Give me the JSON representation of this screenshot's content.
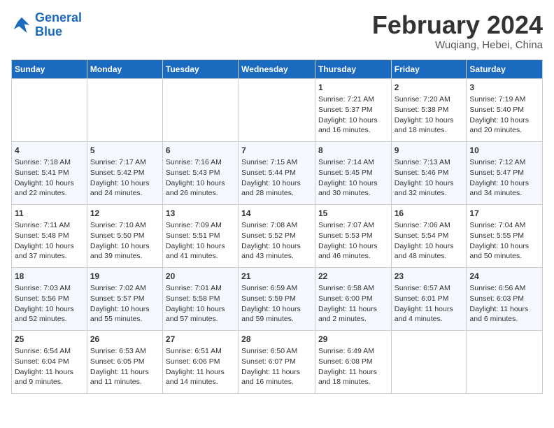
{
  "header": {
    "logo_line1": "General",
    "logo_line2": "Blue",
    "month": "February 2024",
    "location": "Wuqiang, Hebei, China"
  },
  "weekdays": [
    "Sunday",
    "Monday",
    "Tuesday",
    "Wednesday",
    "Thursday",
    "Friday",
    "Saturday"
  ],
  "weeks": [
    [
      {
        "day": "",
        "text": ""
      },
      {
        "day": "",
        "text": ""
      },
      {
        "day": "",
        "text": ""
      },
      {
        "day": "",
        "text": ""
      },
      {
        "day": "1",
        "text": "Sunrise: 7:21 AM\nSunset: 5:37 PM\nDaylight: 10 hours\nand 16 minutes."
      },
      {
        "day": "2",
        "text": "Sunrise: 7:20 AM\nSunset: 5:38 PM\nDaylight: 10 hours\nand 18 minutes."
      },
      {
        "day": "3",
        "text": "Sunrise: 7:19 AM\nSunset: 5:40 PM\nDaylight: 10 hours\nand 20 minutes."
      }
    ],
    [
      {
        "day": "4",
        "text": "Sunrise: 7:18 AM\nSunset: 5:41 PM\nDaylight: 10 hours\nand 22 minutes."
      },
      {
        "day": "5",
        "text": "Sunrise: 7:17 AM\nSunset: 5:42 PM\nDaylight: 10 hours\nand 24 minutes."
      },
      {
        "day": "6",
        "text": "Sunrise: 7:16 AM\nSunset: 5:43 PM\nDaylight: 10 hours\nand 26 minutes."
      },
      {
        "day": "7",
        "text": "Sunrise: 7:15 AM\nSunset: 5:44 PM\nDaylight: 10 hours\nand 28 minutes."
      },
      {
        "day": "8",
        "text": "Sunrise: 7:14 AM\nSunset: 5:45 PM\nDaylight: 10 hours\nand 30 minutes."
      },
      {
        "day": "9",
        "text": "Sunrise: 7:13 AM\nSunset: 5:46 PM\nDaylight: 10 hours\nand 32 minutes."
      },
      {
        "day": "10",
        "text": "Sunrise: 7:12 AM\nSunset: 5:47 PM\nDaylight: 10 hours\nand 34 minutes."
      }
    ],
    [
      {
        "day": "11",
        "text": "Sunrise: 7:11 AM\nSunset: 5:48 PM\nDaylight: 10 hours\nand 37 minutes."
      },
      {
        "day": "12",
        "text": "Sunrise: 7:10 AM\nSunset: 5:50 PM\nDaylight: 10 hours\nand 39 minutes."
      },
      {
        "day": "13",
        "text": "Sunrise: 7:09 AM\nSunset: 5:51 PM\nDaylight: 10 hours\nand 41 minutes."
      },
      {
        "day": "14",
        "text": "Sunrise: 7:08 AM\nSunset: 5:52 PM\nDaylight: 10 hours\nand 43 minutes."
      },
      {
        "day": "15",
        "text": "Sunrise: 7:07 AM\nSunset: 5:53 PM\nDaylight: 10 hours\nand 46 minutes."
      },
      {
        "day": "16",
        "text": "Sunrise: 7:06 AM\nSunset: 5:54 PM\nDaylight: 10 hours\nand 48 minutes."
      },
      {
        "day": "17",
        "text": "Sunrise: 7:04 AM\nSunset: 5:55 PM\nDaylight: 10 hours\nand 50 minutes."
      }
    ],
    [
      {
        "day": "18",
        "text": "Sunrise: 7:03 AM\nSunset: 5:56 PM\nDaylight: 10 hours\nand 52 minutes."
      },
      {
        "day": "19",
        "text": "Sunrise: 7:02 AM\nSunset: 5:57 PM\nDaylight: 10 hours\nand 55 minutes."
      },
      {
        "day": "20",
        "text": "Sunrise: 7:01 AM\nSunset: 5:58 PM\nDaylight: 10 hours\nand 57 minutes."
      },
      {
        "day": "21",
        "text": "Sunrise: 6:59 AM\nSunset: 5:59 PM\nDaylight: 10 hours\nand 59 minutes."
      },
      {
        "day": "22",
        "text": "Sunrise: 6:58 AM\nSunset: 6:00 PM\nDaylight: 11 hours\nand 2 minutes."
      },
      {
        "day": "23",
        "text": "Sunrise: 6:57 AM\nSunset: 6:01 PM\nDaylight: 11 hours\nand 4 minutes."
      },
      {
        "day": "24",
        "text": "Sunrise: 6:56 AM\nSunset: 6:03 PM\nDaylight: 11 hours\nand 6 minutes."
      }
    ],
    [
      {
        "day": "25",
        "text": "Sunrise: 6:54 AM\nSunset: 6:04 PM\nDaylight: 11 hours\nand 9 minutes."
      },
      {
        "day": "26",
        "text": "Sunrise: 6:53 AM\nSunset: 6:05 PM\nDaylight: 11 hours\nand 11 minutes."
      },
      {
        "day": "27",
        "text": "Sunrise: 6:51 AM\nSunset: 6:06 PM\nDaylight: 11 hours\nand 14 minutes."
      },
      {
        "day": "28",
        "text": "Sunrise: 6:50 AM\nSunset: 6:07 PM\nDaylight: 11 hours\nand 16 minutes."
      },
      {
        "day": "29",
        "text": "Sunrise: 6:49 AM\nSunset: 6:08 PM\nDaylight: 11 hours\nand 18 minutes."
      },
      {
        "day": "",
        "text": ""
      },
      {
        "day": "",
        "text": ""
      }
    ]
  ]
}
